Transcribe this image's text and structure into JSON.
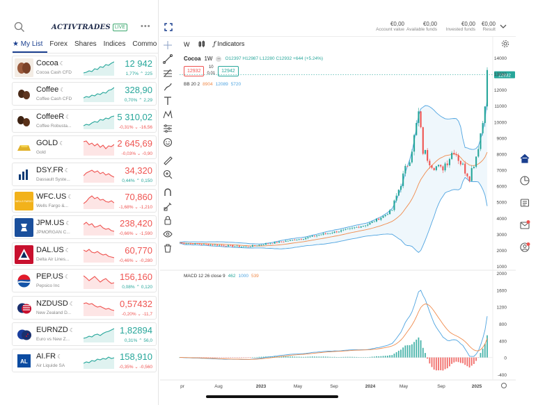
{
  "header": {
    "logo_text": "ACTIVTRADES",
    "live_badge": "LIVE",
    "more_menu": "•••",
    "account": [
      {
        "value": "€0,00",
        "label": "Account value"
      },
      {
        "value": "€0,00",
        "label": "Available funds"
      },
      {
        "value": "€0,00",
        "label": "Invested funds"
      },
      {
        "value": "€0,00",
        "label": "Result"
      }
    ]
  },
  "tabs": [
    "My List",
    "Forex",
    "Shares",
    "Indices",
    "Commo"
  ],
  "watchlist": [
    {
      "name": "Cocoa",
      "sub": "Cocoa Cash CFD",
      "price": "12 942",
      "change": "1,77% ⌃ 225",
      "dir": "up",
      "spark": [
        20,
        19,
        17,
        18,
        14,
        15,
        11,
        12,
        8,
        9,
        6,
        4
      ]
    },
    {
      "name": "Coffee",
      "sub": "Coffee Cash CFD",
      "price": "328,90",
      "change": "0,70% ⌃ 2,29",
      "dir": "up",
      "spark": [
        18,
        16,
        17,
        14,
        15,
        12,
        13,
        10,
        11,
        7,
        6,
        3
      ]
    },
    {
      "name": "CoffeeR",
      "sub": "Coffee Robusta...",
      "price": "5 310,02",
      "change": "-0,31% ⌄ -16,56",
      "dir": "up",
      "spark": [
        19,
        17,
        18,
        15,
        13,
        14,
        10,
        11,
        8,
        9,
        6,
        5
      ]
    },
    {
      "name": "GOLD",
      "sub": "Gold",
      "price": "2 645,69",
      "change": "-0,03% ⌄ -0,90",
      "dir": "dn",
      "spark": [
        4,
        3,
        8,
        6,
        10,
        7,
        12,
        9,
        14,
        10,
        11,
        8
      ]
    },
    {
      "name": "DSY.FR",
      "sub": "Dassault Syste...",
      "price": "34,320",
      "change": "0,44% ⌃ 0,150",
      "dir": "dn",
      "spark": [
        14,
        10,
        8,
        6,
        9,
        7,
        11,
        9,
        13,
        11,
        14,
        16
      ]
    },
    {
      "name": "WFC.US",
      "sub": "Wells Fargo &...",
      "price": "70,860",
      "change": "-1,68% ⌄ -1,210",
      "dir": "dn",
      "spark": [
        16,
        13,
        8,
        5,
        9,
        7,
        11,
        10,
        13,
        14,
        12,
        15
      ]
    },
    {
      "name": "JPM.US",
      "sub": "JPMORGAN C...",
      "price": "238,420",
      "change": "-0,66% ⌄ -1,590",
      "dir": "dn",
      "spark": [
        8,
        5,
        9,
        7,
        12,
        11,
        9,
        13,
        15,
        14,
        17,
        18
      ]
    },
    {
      "name": "DAL.US",
      "sub": "Delta Air Lines...",
      "price": "60,770",
      "change": "-0,46% ⌄ -0,280",
      "dir": "dn",
      "spark": [
        6,
        8,
        5,
        9,
        10,
        8,
        11,
        13,
        12,
        15,
        16,
        17
      ]
    },
    {
      "name": "PEP.US",
      "sub": "Pepsico Inc",
      "price": "156,160",
      "change": "0,08% ⌃ 0,120",
      "dir": "dn",
      "spark": [
        5,
        8,
        12,
        9,
        6,
        10,
        14,
        11,
        9,
        13,
        16,
        15
      ]
    },
    {
      "name": "NZDUSD",
      "sub": "New Zealand D...",
      "price": "0,57432",
      "change": "-0,20% ⌄ -11,7",
      "dir": "dn",
      "spark": [
        6,
        5,
        7,
        6,
        9,
        11,
        10,
        12,
        14,
        13,
        15,
        16
      ]
    },
    {
      "name": "EURNZD",
      "sub": "Euro vs New Z...",
      "price": "1,82894",
      "change": "0,31% ⌃ 56,0",
      "dir": "up",
      "spark": [
        18,
        17,
        15,
        16,
        13,
        12,
        14,
        11,
        9,
        8,
        6,
        4
      ]
    },
    {
      "name": "AI.FR",
      "sub": "Air Liquide SA",
      "price": "158,910",
      "change": "-0,35% ⌄ -0,560",
      "dir": "up",
      "spark": [
        16,
        14,
        15,
        12,
        13,
        10,
        11,
        9,
        10,
        7,
        9,
        8
      ]
    }
  ],
  "toolbar": {
    "interval": "W",
    "indicators": "Indicators"
  },
  "legend": {
    "symbol": "Cocoa",
    "interval": "1W",
    "ohlc": "O12397 H12987 L12280 C12932 +644 (+5.24%)",
    "bid": "12932",
    "ask": "12942",
    "spread_top": "10",
    "spread_bottom": "0.01",
    "bb": {
      "name": "BB 20 2",
      "v1": "8904",
      "v2": "12089",
      "v3": "5720"
    },
    "macd": {
      "name": "MACD 12 26 close 9",
      "v1": "462",
      "v2": "1000",
      "v3": "539"
    }
  },
  "price_axis": [
    "14000",
    "12000",
    "11000",
    "10000",
    "9000",
    "8000",
    "7000",
    "6000",
    "5000",
    "4000",
    "3000",
    "2000",
    "1000"
  ],
  "price_axis_13000": "13000",
  "last_price_tag": "12932",
  "macd_axis": [
    "2000",
    "1600",
    "1200",
    "800",
    "400",
    "0",
    "-400"
  ],
  "time_axis": [
    "pr",
    "Aug",
    "2023",
    "May",
    "Sep",
    "2024",
    "May",
    "Sep",
    "2025"
  ],
  "colors": {
    "up": "#26a69a",
    "down": "#ef5350",
    "accent": "#1a3f8f",
    "bb": "#4da3e0",
    "signal": "#f08a4b"
  },
  "chart_data": {
    "type": "line",
    "title": "Cocoa 1W",
    "xlabel": "",
    "ylabel": "",
    "ylim": [
      1000,
      14000
    ],
    "x": [
      "2022-04",
      "2022-08",
      "2023-01",
      "2023-05",
      "2023-09",
      "2024-01",
      "2024-03",
      "2024-05",
      "2024-07",
      "2024-09",
      "2024-11",
      "2024-12"
    ],
    "series": [
      {
        "name": "Price",
        "values": [
          2450,
          2300,
          2650,
          3000,
          3500,
          4300,
          7500,
          8000,
          7200,
          7000,
          8500,
          12932
        ]
      },
      {
        "name": "BB upper",
        "values": [
          2650,
          2500,
          2850,
          3350,
          3900,
          5000,
          9000,
          11500,
          11000,
          9500,
          10000,
          12089
        ]
      },
      {
        "name": "BB lower",
        "values": [
          2100,
          2050,
          2350,
          2600,
          2950,
          3200,
          1600,
          4800,
          5500,
          6000,
          6200,
          5720
        ]
      },
      {
        "name": "BB basis",
        "values": [
          2380,
          2280,
          2600,
          2950,
          3400,
          4100,
          5500,
          7400,
          8200,
          7600,
          7900,
          8904
        ]
      }
    ]
  }
}
